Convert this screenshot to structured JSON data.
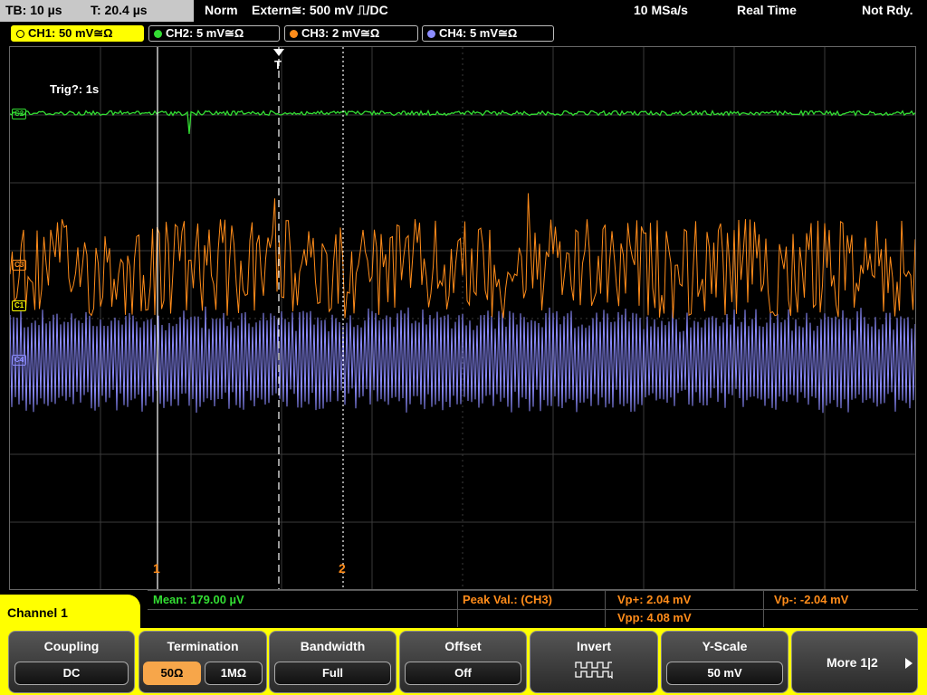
{
  "status": {
    "timebase": "TB: 10 µs",
    "trigger_time": "T: 20.4 µs",
    "mode": "Norm",
    "trigger_source": "Extern≅: 500 mV ⎍/DC",
    "sample_rate": "10 MSa/s",
    "acq_mode": "Real Time",
    "state": "Not Rdy."
  },
  "channels": [
    {
      "label": "CH1: 50 mV≅Ω",
      "color": "#ffff00",
      "active": true
    },
    {
      "label": "CH2: 5 mV≅Ω",
      "color": "#33dd33",
      "active": false
    },
    {
      "label": "CH3: 2 mV≅Ω",
      "color": "#ff8c1a",
      "active": false
    },
    {
      "label": "CH4: 5 mV≅Ω",
      "color": "#8c8cff",
      "active": false
    }
  ],
  "display": {
    "trig_status": "Trig?: 1s",
    "trigger_marker": "T",
    "ch2_marker": "C2",
    "ch3_marker": "C3",
    "ch1_marker": "C1",
    "ch4_marker": "C4",
    "cursor1": "1",
    "cursor2": "2"
  },
  "measurements": {
    "mean": "Mean: 179.00 µV",
    "peak_label": "Peak Val.: (CH3)",
    "vp_plus": "Vp+: 2.04 mV",
    "vp_minus": "Vp-: -2.04 mV",
    "vpp": "Vpp: 4.08 mV"
  },
  "menu": {
    "title": "Channel 1",
    "coupling_label": "Coupling",
    "coupling_value": "DC",
    "termination_label": "Termination",
    "term_50": "50Ω",
    "term_1m": "1MΩ",
    "bandwidth_label": "Bandwidth",
    "bandwidth_value": "Full",
    "offset_label": "Offset",
    "offset_value": "Off",
    "invert_label": "Invert",
    "yscale_label": "Y-Scale",
    "yscale_value": "50 mV",
    "more_label": "More 1|2"
  },
  "colors": {
    "ch1": "#ffff00",
    "ch2": "#33dd33",
    "ch3": "#ff8c1a",
    "ch4": "#8c8cff",
    "softkey_bar": "#ffff00",
    "selected_value": "#f7a64a"
  }
}
